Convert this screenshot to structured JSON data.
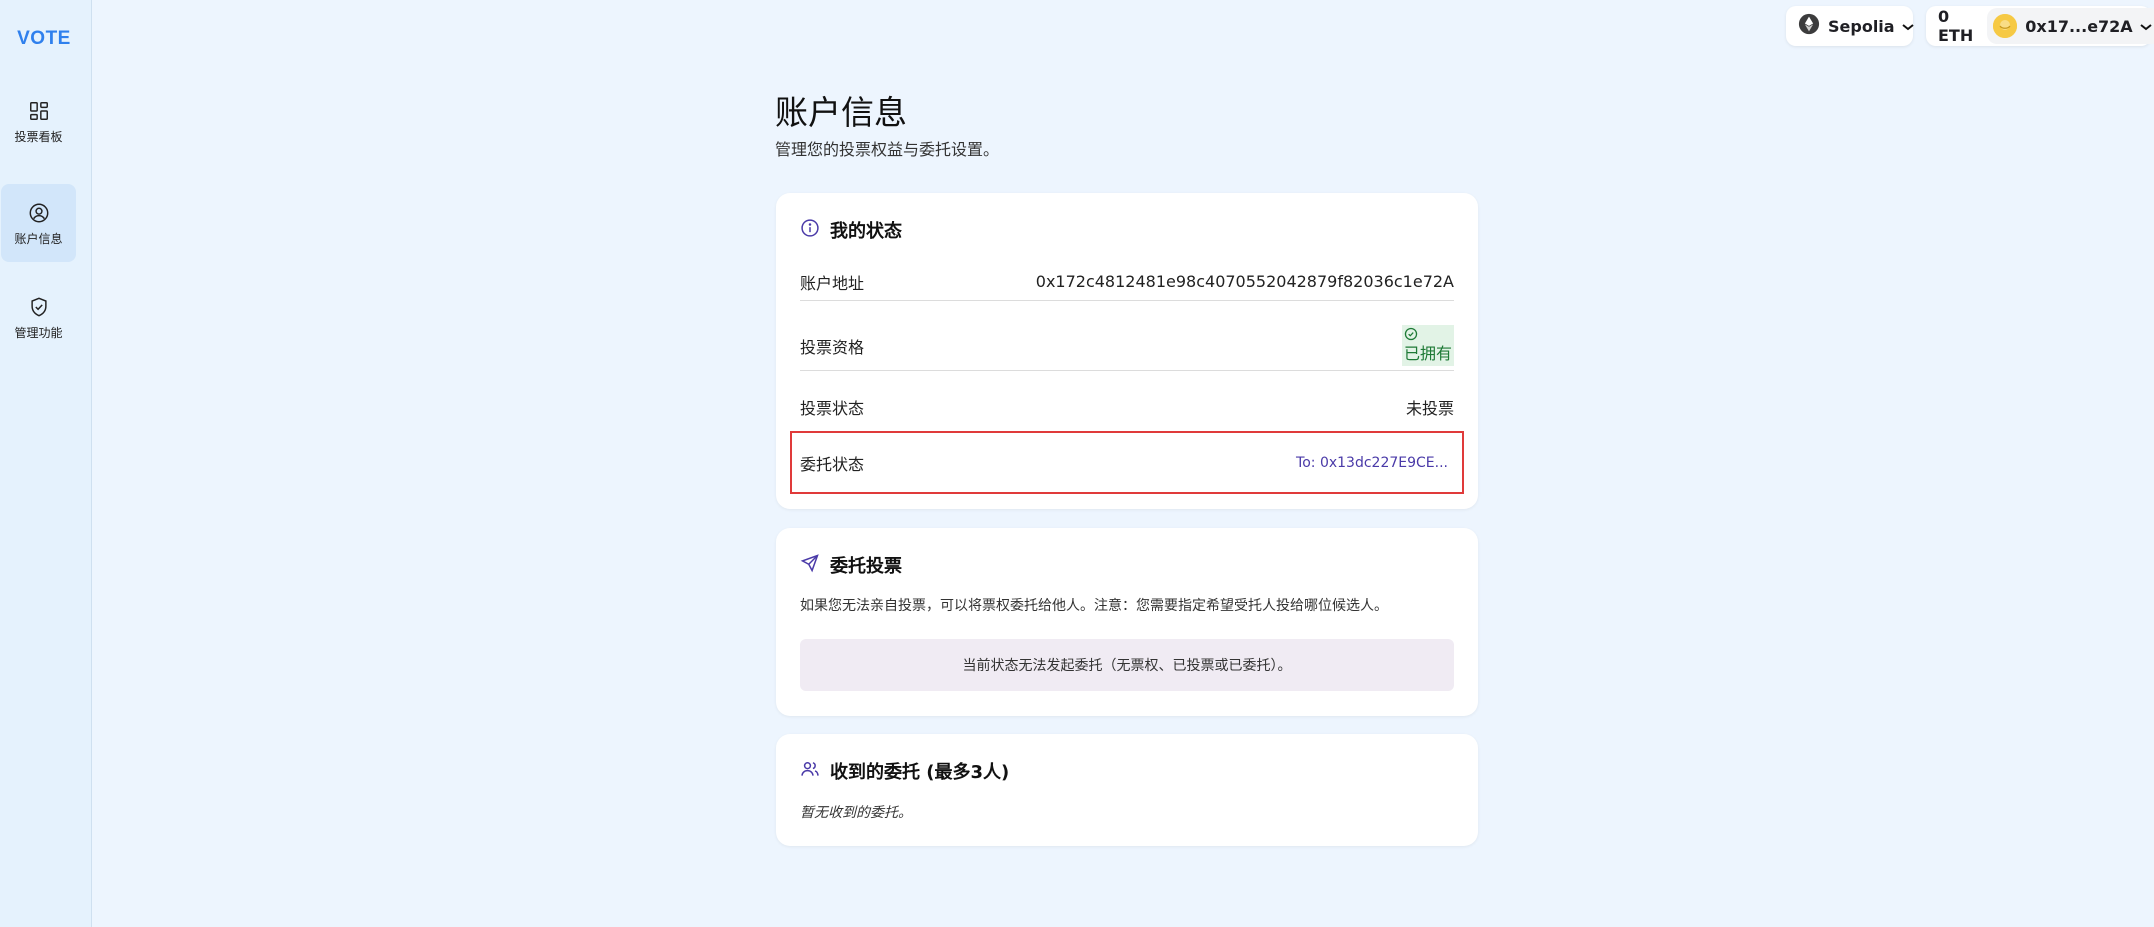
{
  "app": {
    "logo": "VOTE"
  },
  "sidebar": {
    "items": [
      {
        "label": "投票看板",
        "icon": "dashboard-icon"
      },
      {
        "label": "账户信息",
        "icon": "user-circle-icon",
        "active": true
      },
      {
        "label": "管理功能",
        "icon": "shield-check-icon"
      }
    ]
  },
  "topbar": {
    "network": {
      "label": "Sepolia",
      "icon": "ethereum-icon"
    },
    "balance": "0 ETH",
    "account": {
      "address": "0x17...e72A",
      "avatar": "avatar-icon"
    }
  },
  "page": {
    "title": "账户信息",
    "subtitle": "管理您的投票权益与委托设置。"
  },
  "status_card": {
    "title": "我的状态",
    "icon": "info-icon",
    "rows": [
      {
        "label": "账户地址",
        "value": "0x172c4812481e98c4070552042879f82036c1e72A"
      },
      {
        "label": "投票资格",
        "value": "已拥有"
      },
      {
        "label": "投票状态",
        "value": "未投票"
      },
      {
        "label": "委托状态",
        "value": "To: 0x13dc227E9CE..."
      }
    ]
  },
  "delegate_card": {
    "title": "委托投票",
    "icon": "send-icon",
    "description": "如果您无法亲自投票，可以将票权委托给他人。注意：您需要指定希望受托人投给哪位候选人。",
    "notice": "当前状态无法发起委托（无票权、已投票或已委托）。"
  },
  "received_card": {
    "title": "收到的委托 (最多3人)",
    "icon": "users-icon",
    "empty_text": "暂无收到的委托。"
  },
  "colors": {
    "accent": "#2f80ed",
    "page_bg": "#edf5fe",
    "sidebar_bg": "#e5f2fd",
    "success_bg": "#e2f3e6",
    "success_text": "#1e7a36",
    "link": "#4a3aa8",
    "highlight": "#e03a3a"
  }
}
